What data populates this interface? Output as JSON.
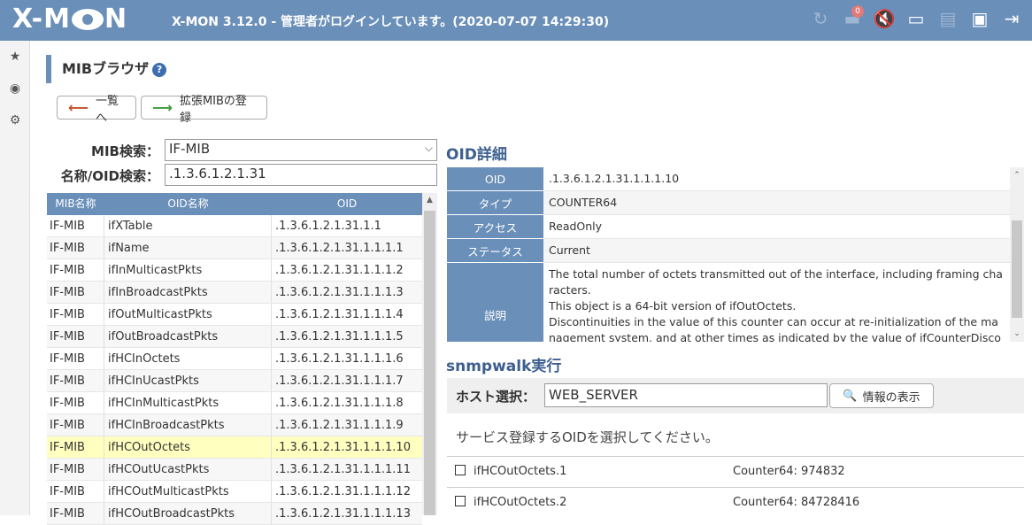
{
  "header": {
    "logo": "X-MON",
    "title": "X-MON 3.12.0 - 管理者がログインしています。(2020-07-07 14:29:30)",
    "notification_count": "0",
    "icons": [
      "refresh-icon",
      "inbox-icon",
      "mute-icon",
      "cast-icon",
      "server-icon",
      "help-icon",
      "logout-icon"
    ]
  },
  "sidebar": {
    "icons": [
      "star-icon",
      "eye-icon",
      "gear-icon"
    ]
  },
  "page": {
    "title": "MIBブラウザ",
    "help": "?"
  },
  "buttons": {
    "back": "一覧へ",
    "register": "拡張MIBの登録"
  },
  "search": {
    "mib_label": "MIB検索：",
    "mib_value": "IF-MIB",
    "name_label": "名称/OID検索：",
    "name_value": ".1.3.6.1.2.1.31"
  },
  "table": {
    "headers": [
      "MIB名称",
      "OID名称",
      "OID"
    ],
    "rows": [
      [
        "IF-MIB",
        "ifXTable",
        ".1.3.6.1.2.1.31.1.1"
      ],
      [
        "IF-MIB",
        "ifName",
        ".1.3.6.1.2.1.31.1.1.1.1"
      ],
      [
        "IF-MIB",
        "ifInMulticastPkts",
        ".1.3.6.1.2.1.31.1.1.1.2"
      ],
      [
        "IF-MIB",
        "ifInBroadcastPkts",
        ".1.3.6.1.2.1.31.1.1.1.3"
      ],
      [
        "IF-MIB",
        "ifOutMulticastPkts",
        ".1.3.6.1.2.1.31.1.1.1.4"
      ],
      [
        "IF-MIB",
        "ifOutBroadcastPkts",
        ".1.3.6.1.2.1.31.1.1.1.5"
      ],
      [
        "IF-MIB",
        "ifHCInOctets",
        ".1.3.6.1.2.1.31.1.1.1.6"
      ],
      [
        "IF-MIB",
        "ifHCInUcastPkts",
        ".1.3.6.1.2.1.31.1.1.1.7"
      ],
      [
        "IF-MIB",
        "ifHCInMulticastPkts",
        ".1.3.6.1.2.1.31.1.1.1.8"
      ],
      [
        "IF-MIB",
        "ifHCInBroadcastPkts",
        ".1.3.6.1.2.1.31.1.1.1.9"
      ],
      [
        "IF-MIB",
        "ifHCOutOctets",
        ".1.3.6.1.2.1.31.1.1.1.10"
      ],
      [
        "IF-MIB",
        "ifHCOutUcastPkts",
        ".1.3.6.1.2.1.31.1.1.1.11"
      ],
      [
        "IF-MIB",
        "ifHCOutMulticastPkts",
        ".1.3.6.1.2.1.31.1.1.1.12"
      ],
      [
        "IF-MIB",
        "ifHCOutBroadcastPkts",
        ".1.3.6.1.2.1.31.1.1.1.13"
      ]
    ],
    "selected_row": 10
  },
  "oid_detail": {
    "title": "OID詳細",
    "rows": [
      {
        "key": "OID",
        "value": ".1.3.6.1.2.1.31.1.1.1.10"
      },
      {
        "key": "タイプ",
        "value": "COUNTER64"
      },
      {
        "key": "アクセス",
        "value": "ReadOnly"
      },
      {
        "key": "ステータス",
        "value": "Current"
      },
      {
        "key": "説明",
        "value": "The total number of octets transmitted out of the interface, including framing characters.\nThis object is a 64-bit version of ifOutOctets.\nDiscontinuities in the value of this counter can occur at re-initialization of the management system, and at other times as indicated by the value of ifCounterDiscontinuityTime."
      }
    ]
  },
  "snmpwalk": {
    "title": "snmpwalk実行",
    "host_label": "ホスト選択：",
    "host_value": "WEB_SERVER",
    "info_button": "情報の表示",
    "message": "サービス登録するOIDを選択してください。",
    "results": [
      {
        "name": "ifHCOutOctets.1",
        "value": "Counter64: 974832"
      },
      {
        "name": "ifHCOutOctets.2",
        "value": "Counter64: 84728416"
      }
    ]
  }
}
